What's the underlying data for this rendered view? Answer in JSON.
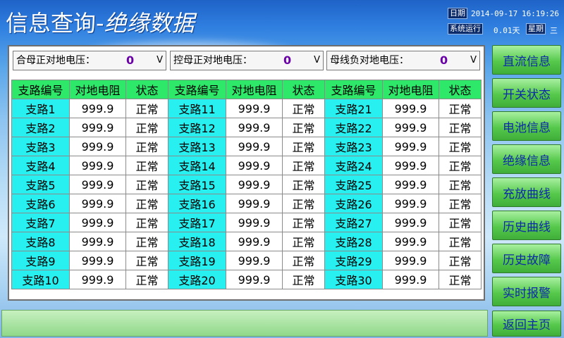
{
  "header": {
    "title_main": "信息查询-",
    "title_sub": "绝缘数据",
    "date_tag": "日期",
    "date_value": "2014-09-17",
    "time_value": "16:19:26",
    "run_tag": "系统运行",
    "run_value": "0.01天",
    "week_tag": "星期",
    "week_value": "三"
  },
  "voltages": [
    {
      "label": "合母正对地电压：",
      "value": "0",
      "unit": "V"
    },
    {
      "label": "控母正对地电压：",
      "value": "0",
      "unit": "V"
    },
    {
      "label": "母线负对地电压：",
      "value": "0",
      "unit": "V"
    }
  ],
  "table": {
    "headers": [
      "支路编号",
      "对地电阻",
      "状态",
      "支路编号",
      "对地电阻",
      "状态",
      "支路编号",
      "对地电阻",
      "状态"
    ],
    "rows": [
      [
        "支路1",
        "999.9",
        "正常",
        "支路11",
        "999.9",
        "正常",
        "支路21",
        "999.9",
        "正常"
      ],
      [
        "支路2",
        "999.9",
        "正常",
        "支路12",
        "999.9",
        "正常",
        "支路22",
        "999.9",
        "正常"
      ],
      [
        "支路3",
        "999.9",
        "正常",
        "支路13",
        "999.9",
        "正常",
        "支路23",
        "999.9",
        "正常"
      ],
      [
        "支路4",
        "999.9",
        "正常",
        "支路14",
        "999.9",
        "正常",
        "支路24",
        "999.9",
        "正常"
      ],
      [
        "支路5",
        "999.9",
        "正常",
        "支路15",
        "999.9",
        "正常",
        "支路25",
        "999.9",
        "正常"
      ],
      [
        "支路6",
        "999.9",
        "正常",
        "支路16",
        "999.9",
        "正常",
        "支路26",
        "999.9",
        "正常"
      ],
      [
        "支路7",
        "999.9",
        "正常",
        "支路17",
        "999.9",
        "正常",
        "支路27",
        "999.9",
        "正常"
      ],
      [
        "支路8",
        "999.9",
        "正常",
        "支路18",
        "999.9",
        "正常",
        "支路28",
        "999.9",
        "正常"
      ],
      [
        "支路9",
        "999.9",
        "正常",
        "支路19",
        "999.9",
        "正常",
        "支路29",
        "999.9",
        "正常"
      ],
      [
        "支路10",
        "999.9",
        "正常",
        "支路20",
        "999.9",
        "正常",
        "支路30",
        "999.9",
        "正常"
      ]
    ]
  },
  "nav": [
    "直流信息",
    "开关状态",
    "电池信息",
    "绝缘信息",
    "充放曲线",
    "历史曲线",
    "历史故障",
    "实时报警"
  ],
  "home_button": "返回主页",
  "colors": {
    "header_cell": "#2ee86a",
    "branch_cell": "#28f0f0",
    "nav_button": "#56c94c",
    "nav_text": "#0d2aa8",
    "voltage_value": "#6a00a8"
  }
}
